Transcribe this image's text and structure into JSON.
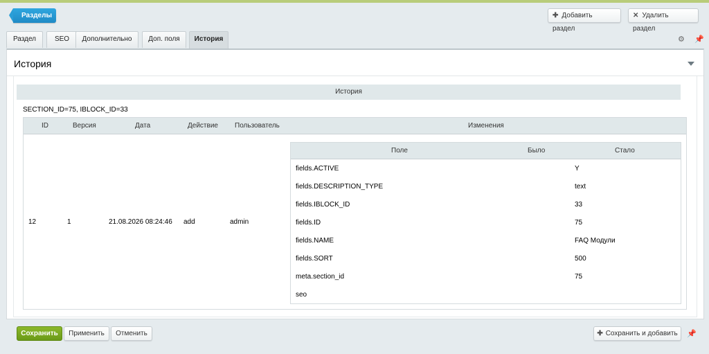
{
  "toolbar": {
    "back_label": "Разделы",
    "add_label": "Добавить раздел",
    "add_icon": "plus-icon",
    "delete_label": "Удалить раздел",
    "delete_icon": "close-icon"
  },
  "tabs": [
    {
      "label": "Раздел"
    },
    {
      "label": "SEO"
    },
    {
      "label": "Дополнительно"
    },
    {
      "label": "Доп. поля"
    },
    {
      "label": "История",
      "active": true
    }
  ],
  "panel": {
    "title": "История",
    "section_header": "История",
    "info": "SECTION_ID=75, IBLOCK_ID=33"
  },
  "history_table": {
    "columns": [
      "ID",
      "Версия",
      "Дата",
      "Действие",
      "Пользователь",
      "Изменения"
    ],
    "row": {
      "id": "12",
      "version": "1",
      "date": "21.08.2026 08:24:46",
      "action": "add",
      "user": "admin"
    }
  },
  "changes_table": {
    "columns": [
      "Поле",
      "Было",
      "Стало"
    ],
    "rows": [
      {
        "field": "fields.ACTIVE",
        "was": "",
        "became": "Y"
      },
      {
        "field": "fields.DESCRIPTION_TYPE",
        "was": "",
        "became": "text"
      },
      {
        "field": "fields.IBLOCK_ID",
        "was": "",
        "became": "33"
      },
      {
        "field": "fields.ID",
        "was": "",
        "became": "75"
      },
      {
        "field": "fields.NAME",
        "was": "",
        "became": "FAQ Модули"
      },
      {
        "field": "fields.SORT",
        "was": "",
        "became": "500"
      },
      {
        "field": "meta.section_id",
        "was": "",
        "became": "75"
      },
      {
        "field": "seo",
        "was": "",
        "became": ""
      }
    ]
  },
  "footer": {
    "save_label": "Сохранить",
    "apply_label": "Применить",
    "cancel_label": "Отменить",
    "save_add_label": "Сохранить и добавить"
  },
  "colors": {
    "accent_blue": "#2a9ed7",
    "save_green": "#7aa820",
    "header_bg": "#e0e8ea"
  }
}
